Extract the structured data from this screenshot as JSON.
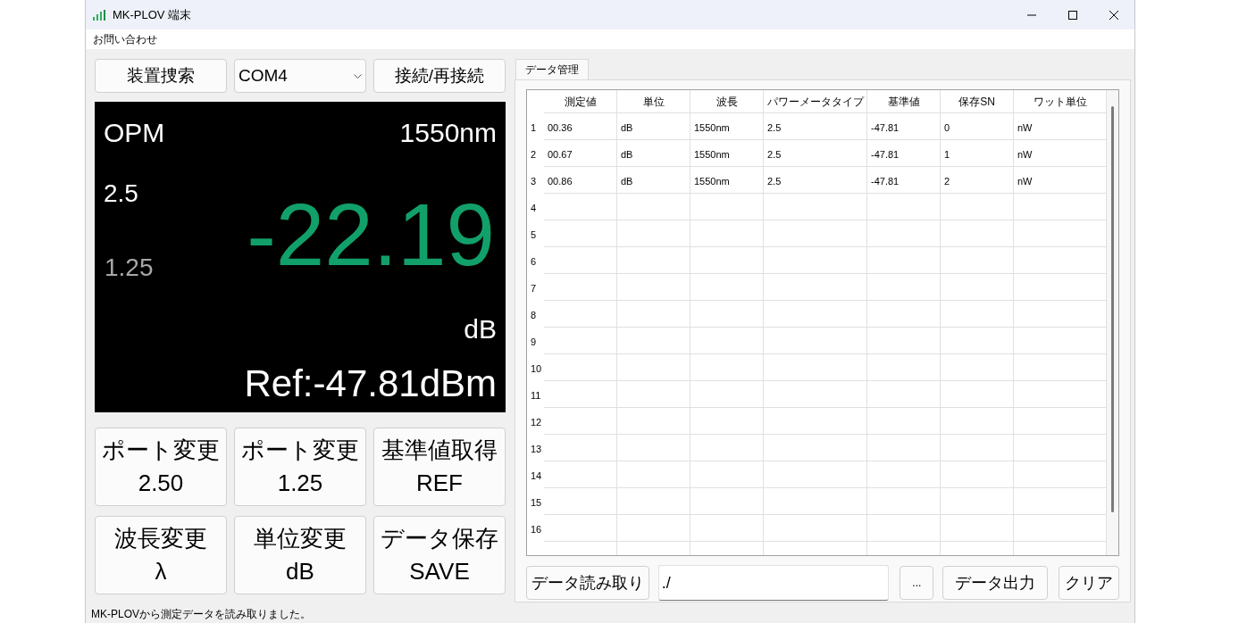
{
  "window": {
    "title": "MK-PLOV 端末"
  },
  "menu": [
    "お問い合わせ"
  ],
  "connection": {
    "search_button": "装置捜索",
    "port": "COM4",
    "connect_button": "接続/再接続"
  },
  "display": {
    "mode": "OPM",
    "wavelength": "1550nm",
    "port_active": "2.5",
    "port_inactive": "1.25",
    "reading": "-22.19",
    "unit": "dB",
    "reference": "Ref:-47.81dBm"
  },
  "control_buttons": [
    {
      "line1": "ポート変更",
      "line2": "2.50"
    },
    {
      "line1": "ポート変更",
      "line2": "1.25"
    },
    {
      "line1": "基準値取得",
      "line2": "REF"
    },
    {
      "line1": "波長変更",
      "line2": "λ"
    },
    {
      "line1": "単位変更",
      "line2": "dB"
    },
    {
      "line1": "データ保存",
      "line2": "SAVE"
    }
  ],
  "tabs": [
    {
      "label": "データ管理",
      "selected": true
    }
  ],
  "table": {
    "columns": [
      "測定値",
      "単位",
      "波長",
      "パワーメータタイプ",
      "基準値",
      "保存SN",
      "ワット単位"
    ],
    "rows": [
      {
        "index": "1",
        "cells": [
          "00.36",
          "dB",
          "1550nm",
          "2.5",
          "-47.81",
          "0",
          "nW"
        ]
      },
      {
        "index": "2",
        "cells": [
          "00.67",
          "dB",
          "1550nm",
          "2.5",
          "-47.81",
          "1",
          "nW"
        ]
      },
      {
        "index": "3",
        "cells": [
          "00.86",
          "dB",
          "1550nm",
          "2.5",
          "-47.81",
          "2",
          "nW"
        ]
      },
      {
        "index": "4",
        "cells": []
      },
      {
        "index": "5",
        "cells": []
      },
      {
        "index": "6",
        "cells": []
      },
      {
        "index": "7",
        "cells": []
      },
      {
        "index": "8",
        "cells": []
      },
      {
        "index": "9",
        "cells": []
      },
      {
        "index": "10",
        "cells": []
      },
      {
        "index": "11",
        "cells": []
      },
      {
        "index": "12",
        "cells": []
      },
      {
        "index": "13",
        "cells": []
      },
      {
        "index": "14",
        "cells": []
      },
      {
        "index": "15",
        "cells": []
      },
      {
        "index": "16",
        "cells": []
      }
    ]
  },
  "bottom_bar": {
    "read_button": "データ読み取り",
    "path": "./",
    "browse_button": "...",
    "export_button": "データ出力",
    "clear_button": "クリア"
  },
  "status_bar": "MK-PLOVから測定データを読み取りました。"
}
